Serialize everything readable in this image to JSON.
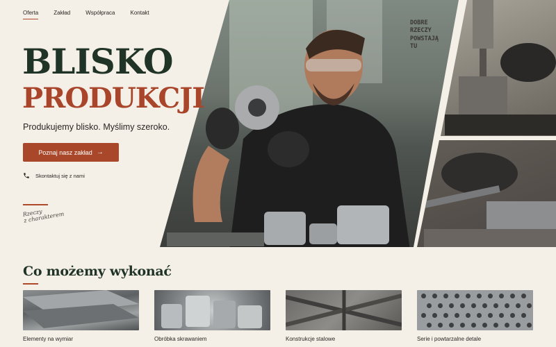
{
  "nav": {
    "items": [
      {
        "label": "Oferta",
        "active": true
      },
      {
        "label": "Zakład",
        "active": false
      },
      {
        "label": "Współpraca",
        "active": false
      },
      {
        "label": "Kontakt",
        "active": false
      }
    ]
  },
  "hero": {
    "title_line1": "BLISKO",
    "title_line2": "PRODUKCJI",
    "tagline": "Produkujemy blisko. Myślimy szeroko.",
    "cta_label": "Poznaj nasz zakład",
    "cta_icon": "arrow-right-icon",
    "contact_label": "Skontaktuj się z nami",
    "contact_icon": "phone-icon",
    "signature_line1": "Rzeczy",
    "signature_line2": "z charakterem",
    "wall_sign": [
      "DOBRE",
      "RZECZY",
      "POWSTAJĄ",
      "TU"
    ]
  },
  "services": {
    "title": "Co możemy wykonać",
    "cards": [
      {
        "label": "Elementy na wymiar",
        "image": "steel-plates"
      },
      {
        "label": "Obróbka skrawaniem",
        "image": "machined-parts"
      },
      {
        "label": "Konstrukcje stalowe",
        "image": "steel-frame"
      },
      {
        "label": "Serie i powtarzalne detale",
        "image": "perforated-sheet"
      }
    ]
  },
  "colors": {
    "background": "#f4efe7",
    "brand_green": "#1f3326",
    "accent_rust": "#a9472a"
  }
}
